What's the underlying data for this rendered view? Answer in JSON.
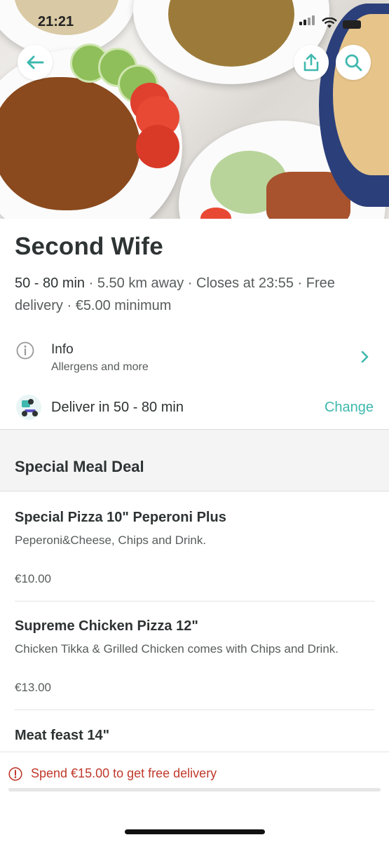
{
  "status_bar": {
    "time": "21:21"
  },
  "colors": {
    "accent": "#3fb8ae",
    "warning": "#c0392b",
    "text": "#2e3333",
    "muted": "#585c5c"
  },
  "header": {
    "back_icon": "arrow-left-icon",
    "share_icon": "share-icon",
    "search_icon": "search-icon"
  },
  "restaurant": {
    "name": "Second Wife",
    "delivery_time": "50 - 80 min",
    "meta_rest": "5.50 km away · Closes at 23:55 · Free delivery · €5.00 minimum"
  },
  "info_row": {
    "label": "Info",
    "sublabel": "Allergens and more",
    "icon": "info-icon"
  },
  "delivery_row": {
    "label": "Deliver in 50 - 80 min",
    "action": "Change",
    "icon": "rider-icon"
  },
  "section": {
    "title": "Special Meal Deal"
  },
  "menu_items": [
    {
      "name": "Special Pizza 10\" Peperoni Plus",
      "description": "Peperoni&Cheese, Chips and Drink.",
      "price": "€10.00"
    },
    {
      "name": "Supreme Chicken Pizza 12\"",
      "description": "Chicken Tikka & Grilled Chicken comes with Chips and Drink.",
      "price": "€13.00"
    },
    {
      "name": "Meat feast 14\""
    }
  ],
  "footer": {
    "promo": "Spend €15.00 to get free delivery",
    "promo_icon": "info-icon"
  }
}
